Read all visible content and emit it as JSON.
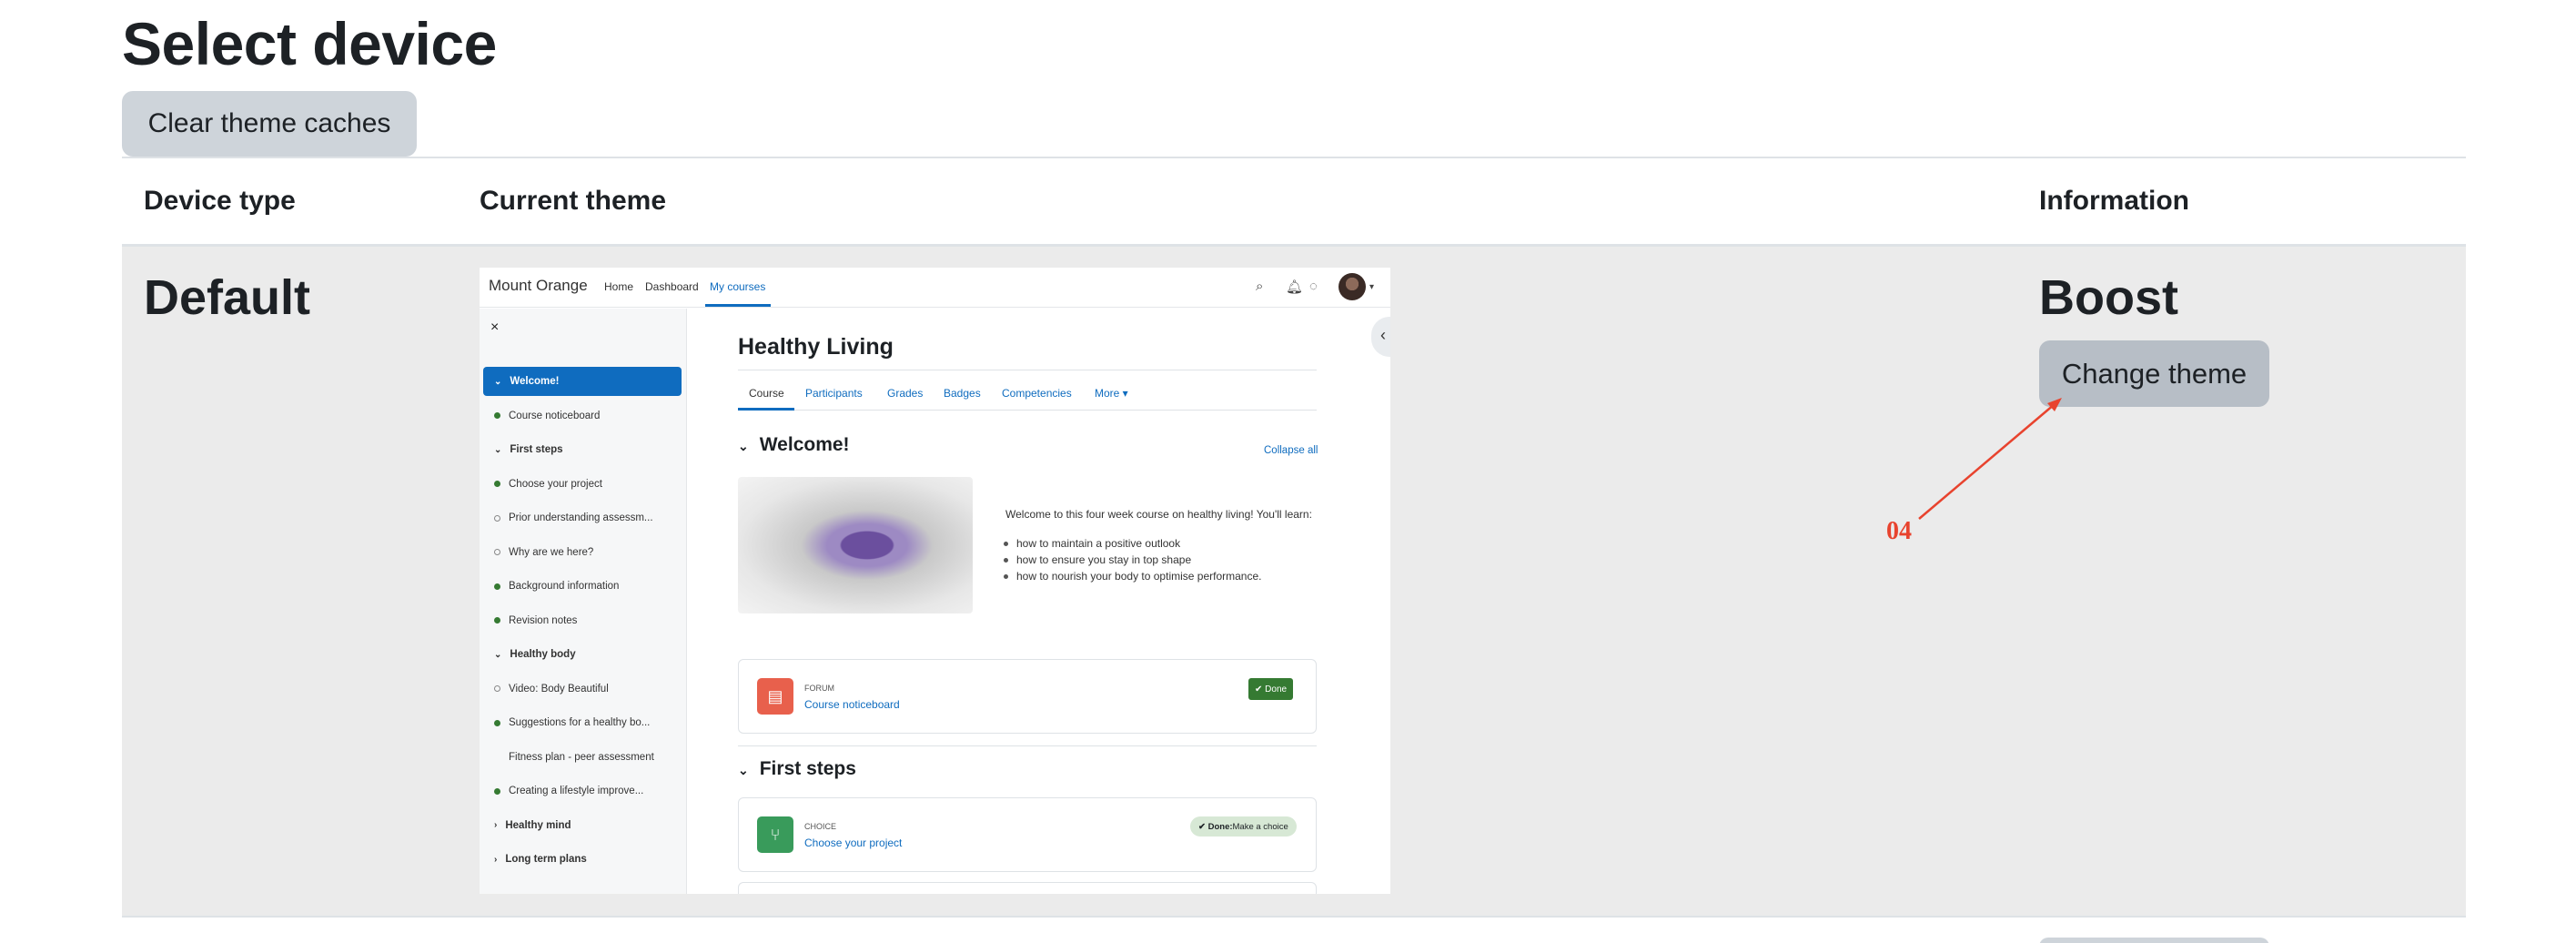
{
  "page": {
    "title": "Select device",
    "clear_button": "Clear theme caches"
  },
  "table": {
    "headers": [
      "Device type",
      "Current theme",
      "Information"
    ],
    "rows": [
      {
        "device": "Default",
        "theme": "Boost",
        "action": "Change theme"
      }
    ]
  },
  "annotation": {
    "label": "04",
    "color": "#e8432e"
  },
  "preview": {
    "brand": "Mount Orange",
    "nav": [
      "Home",
      "Dashboard",
      "My courses"
    ],
    "active_nav": "My courses",
    "icons": [
      "search-icon",
      "bell-icon",
      "chat-icon",
      "avatar"
    ],
    "sidebar": {
      "close": "×",
      "items": [
        {
          "label": "Welcome!",
          "kind": "section",
          "active": true,
          "chev": "⌄"
        },
        {
          "label": "Course noticeboard",
          "kind": "done"
        },
        {
          "label": "First steps",
          "kind": "section",
          "chev": "⌄"
        },
        {
          "label": "Choose your project",
          "kind": "done"
        },
        {
          "label": "Prior understanding assessm...",
          "kind": "todo"
        },
        {
          "label": "Why are we here?",
          "kind": "todo"
        },
        {
          "label": "Background information",
          "kind": "done"
        },
        {
          "label": "Revision notes",
          "kind": "done"
        },
        {
          "label": "Healthy body",
          "kind": "section",
          "chev": "⌄"
        },
        {
          "label": "Video: Body Beautiful",
          "kind": "todo"
        },
        {
          "label": "Suggestions for a healthy bo...",
          "kind": "done"
        },
        {
          "label": "Fitness plan - peer assessment",
          "kind": "none"
        },
        {
          "label": "Creating a lifestyle improve...",
          "kind": "done"
        },
        {
          "label": "Healthy mind",
          "kind": "section",
          "chev": "›"
        },
        {
          "label": "Long term plans",
          "kind": "section",
          "chev": "›"
        }
      ]
    },
    "course_title": "Healthy Living",
    "tabs": [
      "Course",
      "Participants",
      "Grades",
      "Badges",
      "Competencies",
      "More ▾"
    ],
    "section1": "Welcome!",
    "collapse_all": "Collapse all",
    "intro": "Welcome to this four week course on healthy living! You'll learn:",
    "bullets": [
      "how to maintain a positive outlook",
      "how to ensure you stay in top shape",
      "how to nourish your body to optimise performance."
    ],
    "card1": {
      "kind": "FORUM",
      "link": "Course noticeboard",
      "status": "✔ Done",
      "color": "#e8604c"
    },
    "section2": "First steps",
    "card2": {
      "kind": "CHOICE",
      "link": "Choose your project",
      "status_strong": "✔ Done:",
      "status_rest": " Make a choice",
      "color": "#399b5b"
    },
    "colors": {
      "primary": "#0f6cbf",
      "done": "#357a32"
    }
  }
}
